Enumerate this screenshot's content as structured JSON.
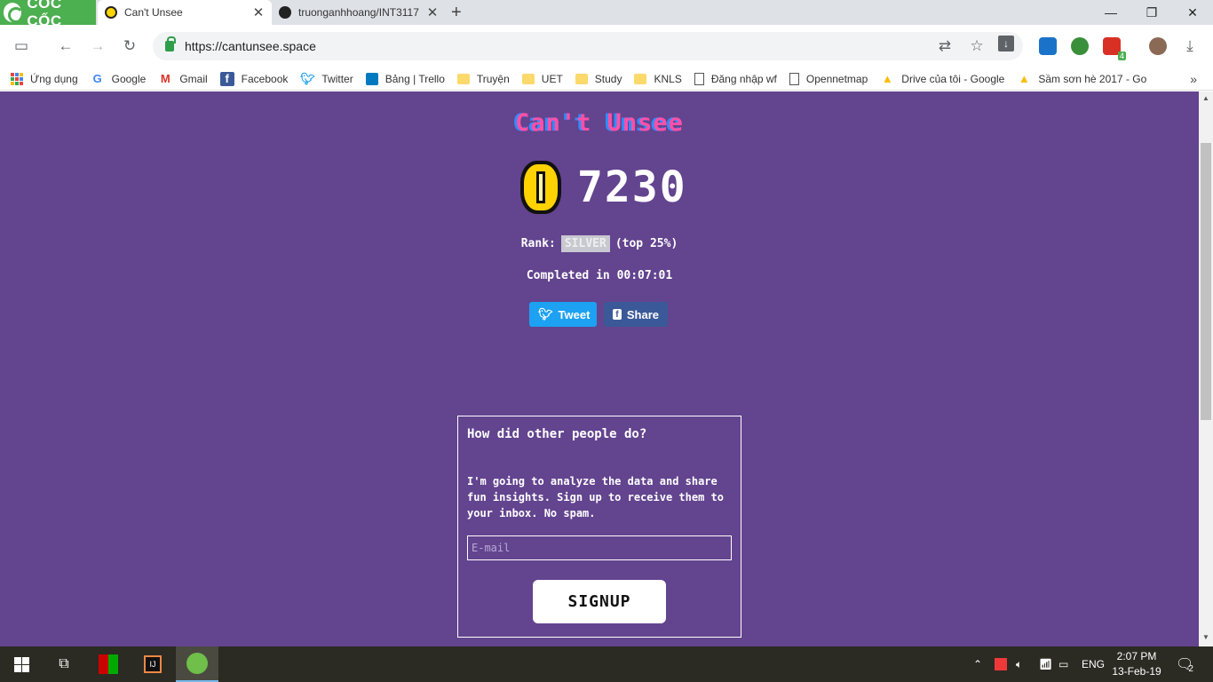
{
  "browser": {
    "brand": "CỐC CỐC",
    "tabs": [
      {
        "title": "Can't Unsee",
        "active": true
      },
      {
        "title": "truonganhhoang/INT3117",
        "active": false
      }
    ],
    "url": "https://cantunsee.space",
    "bookmarks": [
      {
        "label": "Ứng dụng",
        "icon": "apps-icon"
      },
      {
        "label": "Google",
        "icon": "google-icon"
      },
      {
        "label": "Gmail",
        "icon": "gmail-icon"
      },
      {
        "label": "Facebook",
        "icon": "facebook-icon"
      },
      {
        "label": "Twitter",
        "icon": "twitter-icon"
      },
      {
        "label": "Bảng | Trello",
        "icon": "trello-icon"
      },
      {
        "label": "Truyện",
        "icon": "folder-icon"
      },
      {
        "label": "UET",
        "icon": "folder-icon"
      },
      {
        "label": "Study",
        "icon": "folder-icon"
      },
      {
        "label": "KNLS",
        "icon": "folder-icon"
      },
      {
        "label": "Đăng nhập wf",
        "icon": "page-icon"
      },
      {
        "label": "Opennetmap",
        "icon": "page-icon"
      },
      {
        "label": "Drive của tôi - Google",
        "icon": "drive-icon"
      },
      {
        "label": "Sầm sơn hè 2017 - Go",
        "icon": "drive-icon"
      }
    ],
    "extension_badge": "4"
  },
  "page": {
    "title": "Can't Unsee",
    "score": "7230",
    "rank_label": "Rank:",
    "rank": "SILVER",
    "rank_note": "(top 25%)",
    "completed_label": "Completed in",
    "completed_time": "00:07:01",
    "tweet_label": "Tweet",
    "share_label": "Share",
    "signup": {
      "heading": "How did other people do?",
      "text": "I'm going to analyze the data and share fun insights. Sign up to receive them to your inbox. No spam.",
      "email_placeholder": "E-mail",
      "button": "SIGNUP"
    }
  },
  "taskbar": {
    "language": "ENG",
    "time": "2:07 PM",
    "date": "13-Feb-19",
    "notifications": "2"
  }
}
